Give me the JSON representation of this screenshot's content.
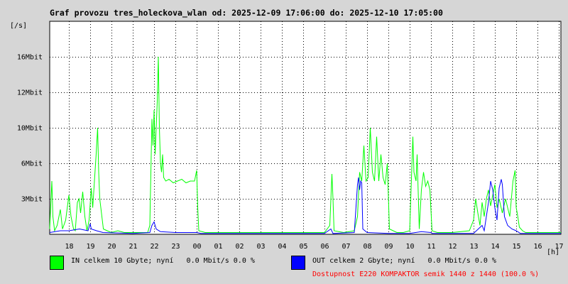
{
  "title": "Graf provozu tres_holeckova_wlan od: 2025-12-09 17:06:00 do: 2025-12-10 17:05:00",
  "chart_data": {
    "type": "line",
    "title": "Graf provozu tres_holeckova_wlan od: 2025-12-09 17:06:00 do: 2025-12-10 17:05:00",
    "ylabel": "[/s]",
    "xlabel": "[h]",
    "x_ticks": [
      "18",
      "19",
      "20",
      "21",
      "22",
      "23",
      "00",
      "01",
      "02",
      "03",
      "04",
      "05",
      "06",
      "07",
      "08",
      "09",
      "10",
      "11",
      "12",
      "13",
      "14",
      "15",
      "16",
      "17"
    ],
    "x_range": [
      17.1,
      41.1
    ],
    "y_ticks": [
      {
        "label": "3Mbit",
        "value": 2
      },
      {
        "label": "6Mbit",
        "value": 4
      },
      {
        "label": "10Mbit",
        "value": 6
      },
      {
        "label": "12Mbit",
        "value": 8
      },
      {
        "label": "16Mbit",
        "value": 10
      }
    ],
    "ylim": [
      0,
      12
    ],
    "grid": true,
    "series": [
      {
        "name": "IN celkem 10 Gbyte; nyní   0.0 Mbit/s 0.0 %",
        "color": "#00ff00",
        "points": [
          [
            17.1,
            0.3
          ],
          [
            17.2,
            3.0
          ],
          [
            17.25,
            1.0
          ],
          [
            17.33,
            0.2
          ],
          [
            17.45,
            0.5
          ],
          [
            17.6,
            1.4
          ],
          [
            17.7,
            0.3
          ],
          [
            17.85,
            0.8
          ],
          [
            18.0,
            2.2
          ],
          [
            18.1,
            1.0
          ],
          [
            18.22,
            0.3
          ],
          [
            18.3,
            0.2
          ],
          [
            18.4,
            1.8
          ],
          [
            18.48,
            2.0
          ],
          [
            18.55,
            1.2
          ],
          [
            18.65,
            2.4
          ],
          [
            18.75,
            1.0
          ],
          [
            18.85,
            0.2
          ],
          [
            18.95,
            0.8
          ],
          [
            19.05,
            2.6
          ],
          [
            19.12,
            1.5
          ],
          [
            19.2,
            3.0
          ],
          [
            19.28,
            4.5
          ],
          [
            19.35,
            6.0
          ],
          [
            19.4,
            3.5
          ],
          [
            19.45,
            2.0
          ],
          [
            19.55,
            1.0
          ],
          [
            19.62,
            0.3
          ],
          [
            19.8,
            0.2
          ],
          [
            20.0,
            0.1
          ],
          [
            20.3,
            0.2
          ],
          [
            20.6,
            0.1
          ],
          [
            21.0,
            0.1
          ],
          [
            21.4,
            0.1
          ],
          [
            21.7,
            0.1
          ],
          [
            21.8,
            0.5
          ],
          [
            21.85,
            3.5
          ],
          [
            21.9,
            6.5
          ],
          [
            21.95,
            5.0
          ],
          [
            22.0,
            7.0
          ],
          [
            22.05,
            4.5
          ],
          [
            22.1,
            6.0
          ],
          [
            22.15,
            7.5
          ],
          [
            22.2,
            10.0
          ],
          [
            22.25,
            6.0
          ],
          [
            22.3,
            4.0
          ],
          [
            22.35,
            3.5
          ],
          [
            22.4,
            4.5
          ],
          [
            22.45,
            3.2
          ],
          [
            22.55,
            3.0
          ],
          [
            22.7,
            3.1
          ],
          [
            22.9,
            2.9
          ],
          [
            23.1,
            3.0
          ],
          [
            23.3,
            3.1
          ],
          [
            23.5,
            2.9
          ],
          [
            23.7,
            3.0
          ],
          [
            23.9,
            3.0
          ],
          [
            24.0,
            3.6
          ],
          [
            24.05,
            1.5
          ],
          [
            24.1,
            0.2
          ],
          [
            24.4,
            0.1
          ],
          [
            25.0,
            0.1
          ],
          [
            26.0,
            0.1
          ],
          [
            27.0,
            0.1
          ],
          [
            28.0,
            0.1
          ],
          [
            29.0,
            0.1
          ],
          [
            29.5,
            0.1
          ],
          [
            30.0,
            0.1
          ],
          [
            30.25,
            0.5
          ],
          [
            30.35,
            3.4
          ],
          [
            30.4,
            2.0
          ],
          [
            30.45,
            0.2
          ],
          [
            30.9,
            0.1
          ],
          [
            31.4,
            0.2
          ],
          [
            31.55,
            1.0
          ],
          [
            31.65,
            3.5
          ],
          [
            31.75,
            3.0
          ],
          [
            31.85,
            5.0
          ],
          [
            31.95,
            3.0
          ],
          [
            32.05,
            3.2
          ],
          [
            32.15,
            6.0
          ],
          [
            32.25,
            3.5
          ],
          [
            32.35,
            3.0
          ],
          [
            32.45,
            5.5
          ],
          [
            32.55,
            3.0
          ],
          [
            32.65,
            4.5
          ],
          [
            32.75,
            3.2
          ],
          [
            32.85,
            2.8
          ],
          [
            32.95,
            4.0
          ],
          [
            33.05,
            0.3
          ],
          [
            33.4,
            0.1
          ],
          [
            33.7,
            0.1
          ],
          [
            34.0,
            0.2
          ],
          [
            34.15,
            5.5
          ],
          [
            34.2,
            3.5
          ],
          [
            34.3,
            3.0
          ],
          [
            34.35,
            4.5
          ],
          [
            34.45,
            0.3
          ],
          [
            34.55,
            2.5
          ],
          [
            34.65,
            3.5
          ],
          [
            34.75,
            2.7
          ],
          [
            34.85,
            3.0
          ],
          [
            34.95,
            2.5
          ],
          [
            35.05,
            0.2
          ],
          [
            35.3,
            0.1
          ],
          [
            36.0,
            0.1
          ],
          [
            36.8,
            0.2
          ],
          [
            37.0,
            0.8
          ],
          [
            37.1,
            2.0
          ],
          [
            37.2,
            1.2
          ],
          [
            37.3,
            0.5
          ],
          [
            37.4,
            1.8
          ],
          [
            37.5,
            1.0
          ],
          [
            37.6,
            2.0
          ],
          [
            37.7,
            2.5
          ],
          [
            37.8,
            1.6
          ],
          [
            37.9,
            2.2
          ],
          [
            38.0,
            2.8
          ],
          [
            38.1,
            1.5
          ],
          [
            38.2,
            2.0
          ],
          [
            38.35,
            1.2
          ],
          [
            38.5,
            2.0
          ],
          [
            38.7,
            1.0
          ],
          [
            38.85,
            3.0
          ],
          [
            38.95,
            3.6
          ],
          [
            39.0,
            1.5
          ],
          [
            39.05,
            1.2
          ],
          [
            39.15,
            0.4
          ],
          [
            39.3,
            0.2
          ],
          [
            39.45,
            0.1
          ],
          [
            40.0,
            0.1
          ],
          [
            40.5,
            0.1
          ],
          [
            41.1,
            0.1
          ]
        ]
      },
      {
        "name": "OUT celkem 2 Gbyte; nyní   0.0 Mbit/s 0.0 %",
        "color": "#0000ff",
        "points": [
          [
            17.1,
            0.1
          ],
          [
            17.6,
            0.2
          ],
          [
            18.0,
            0.2
          ],
          [
            18.5,
            0.3
          ],
          [
            18.9,
            0.2
          ],
          [
            19.0,
            0.6
          ],
          [
            19.05,
            0.3
          ],
          [
            19.3,
            0.2
          ],
          [
            19.6,
            0.1
          ],
          [
            21.0,
            0.05
          ],
          [
            21.8,
            0.1
          ],
          [
            21.9,
            0.5
          ],
          [
            22.0,
            0.7
          ],
          [
            22.1,
            0.3
          ],
          [
            22.3,
            0.15
          ],
          [
            23.0,
            0.1
          ],
          [
            24.0,
            0.1
          ],
          [
            24.2,
            0.05
          ],
          [
            27.0,
            0.05
          ],
          [
            30.0,
            0.05
          ],
          [
            30.3,
            0.3
          ],
          [
            30.4,
            0.05
          ],
          [
            31.4,
            0.1
          ],
          [
            31.55,
            2.8
          ],
          [
            31.6,
            3.2
          ],
          [
            31.65,
            2.5
          ],
          [
            31.7,
            3.0
          ],
          [
            31.75,
            2.9
          ],
          [
            31.8,
            0.3
          ],
          [
            32.0,
            0.1
          ],
          [
            33.0,
            0.05
          ],
          [
            34.0,
            0.05
          ],
          [
            34.55,
            0.15
          ],
          [
            35.0,
            0.1
          ],
          [
            35.05,
            0.05
          ],
          [
            36.0,
            0.05
          ],
          [
            37.0,
            0.05
          ],
          [
            37.4,
            0.5
          ],
          [
            37.5,
            0.2
          ],
          [
            37.7,
            1.8
          ],
          [
            37.8,
            3.0
          ],
          [
            37.9,
            2.5
          ],
          [
            38.0,
            1.5
          ],
          [
            38.1,
            0.8
          ],
          [
            38.2,
            2.6
          ],
          [
            38.3,
            3.1
          ],
          [
            38.35,
            2.8
          ],
          [
            38.45,
            1.0
          ],
          [
            38.6,
            0.5
          ],
          [
            38.8,
            0.3
          ],
          [
            39.0,
            0.2
          ],
          [
            39.2,
            0.05
          ],
          [
            40.0,
            0.05
          ],
          [
            41.1,
            0.05
          ]
        ]
      }
    ]
  },
  "legend": {
    "in": {
      "color": "#00ff00",
      "text": "IN celkem 10 Gbyte; nyní   0.0 Mbit/s 0.0 %"
    },
    "out": {
      "color": "#0000ff",
      "text": "OUT celkem 2 Gbyte; nyní   0.0 Mbit/s 0.0 %"
    }
  },
  "availability": "Dostupnost E220 KOMPAKTOR semik 1440 z 1440 (100.0 %)"
}
